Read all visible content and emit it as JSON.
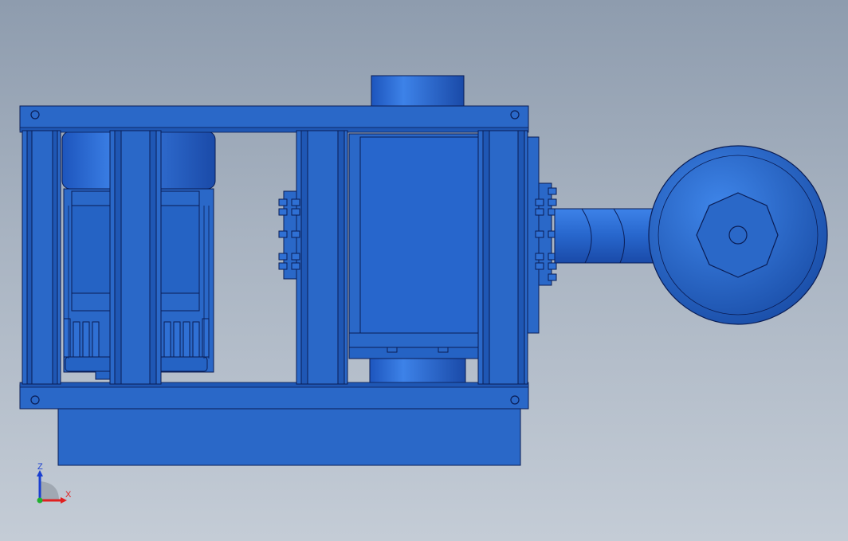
{
  "view": {
    "background_top": "#8e9cae",
    "background_bottom": "#c4ccd6",
    "model_color": "#2a68c8",
    "model_shadow": "#1c4fa8",
    "edge_color": "#0a1d55"
  },
  "triad": {
    "z_label": "Z",
    "x_label": "X",
    "z_color": "#1a3fd0",
    "x_color": "#e02020",
    "y_color": "#20b030"
  }
}
